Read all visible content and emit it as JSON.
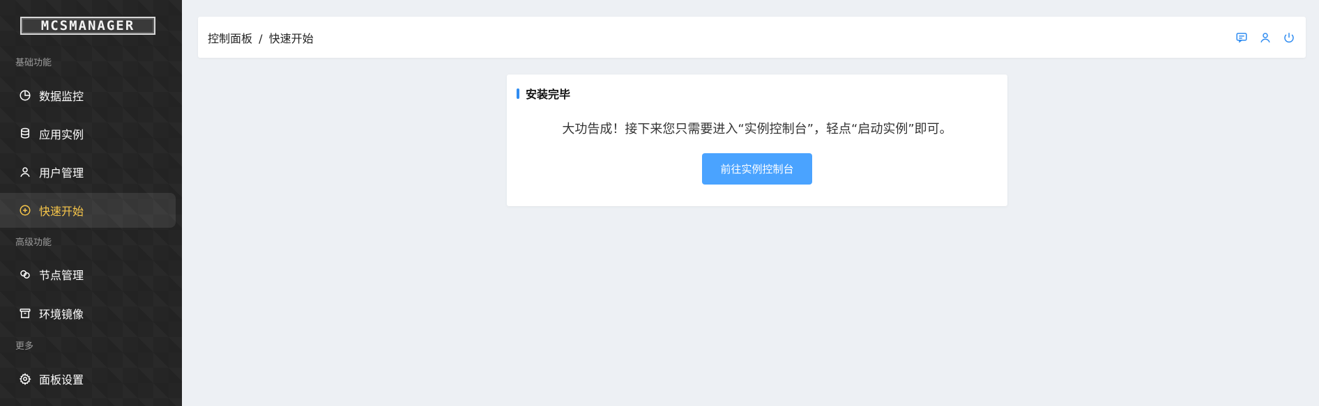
{
  "sidebar": {
    "logo_text": "MCSMANAGER",
    "sections": [
      {
        "label": "基础功能",
        "items": [
          {
            "label": "数据监控",
            "icon": "chart-pie-icon",
            "active": false
          },
          {
            "label": "应用实例",
            "icon": "database-icon",
            "active": false
          },
          {
            "label": "用户管理",
            "icon": "user-icon",
            "active": false
          },
          {
            "label": "快速开始",
            "icon": "plus-circle-icon",
            "active": true
          }
        ]
      },
      {
        "label": "高级功能",
        "items": [
          {
            "label": "节点管理",
            "icon": "cluster-icon",
            "active": false
          },
          {
            "label": "环境镜像",
            "icon": "archive-icon",
            "active": false
          }
        ]
      },
      {
        "label": "更多",
        "items": [
          {
            "label": "面板设置",
            "icon": "gear-icon",
            "active": false
          }
        ]
      }
    ]
  },
  "header": {
    "breadcrumb": {
      "parent": "控制面板",
      "separator": "/",
      "current": "快速开始"
    },
    "actions": {
      "icons": [
        "message-icon",
        "user-icon",
        "power-icon"
      ]
    }
  },
  "card": {
    "title": "安装完毕",
    "message": "大功告成！接下来您只需要进入“实例控制台”，轻点“启动实例”即可。",
    "button_label": "前往实例控制台"
  },
  "colors": {
    "sidebar_bg": "#252525",
    "active_text": "#f7c64a",
    "accent_blue": "#2f8cf1",
    "button_blue": "#4aa3ff",
    "page_bg": "#edf0f4"
  }
}
